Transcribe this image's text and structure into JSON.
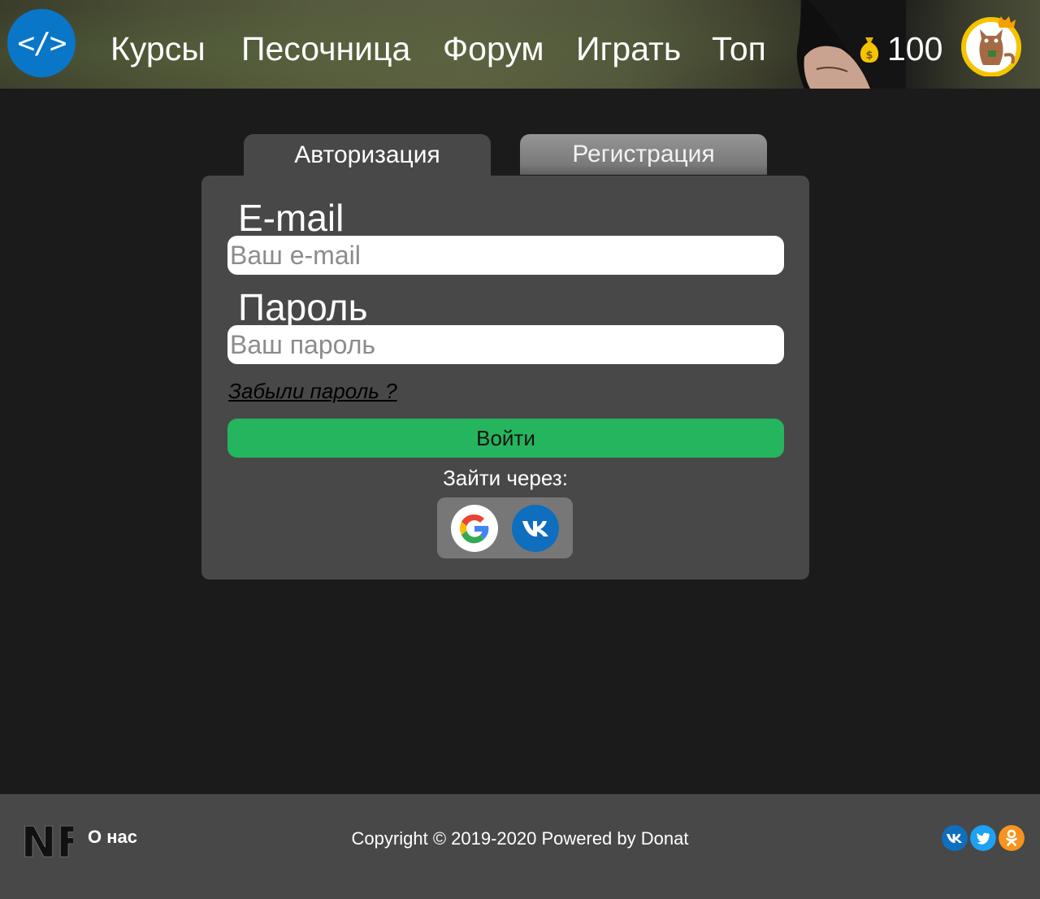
{
  "header": {
    "logo_text": "</>",
    "nav": [
      "Курсы",
      "Песочница",
      "Форум",
      "Играть",
      "Топ"
    ],
    "coins": "100"
  },
  "tabs": {
    "login": "Авторизация",
    "register": "Регистрация"
  },
  "form": {
    "email_label": "E-mail",
    "email_placeholder": "Ваш e-mail",
    "password_label": "Пароль",
    "password_placeholder": "Ваш пароль",
    "forgot": "Забыли пароль ?",
    "submit": "Войти",
    "login_via": "Зайти через:"
  },
  "footer": {
    "logo_text": "NF",
    "about": "О нас",
    "copyright": "Copyright © 2019-2020 Powered by Donat"
  },
  "colors": {
    "accent_green": "#25b55e",
    "logo_blue": "#0a76c8",
    "panel": "#484848",
    "background": "#1b1b1b"
  }
}
